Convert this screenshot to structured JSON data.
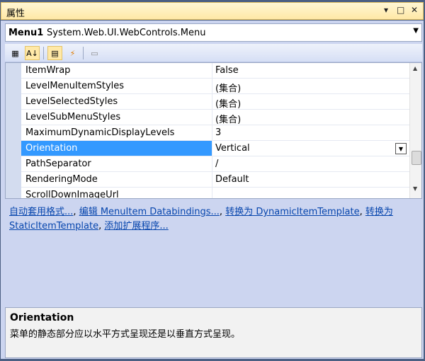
{
  "window": {
    "title": "属性",
    "controls": [
      "▾",
      "□",
      "✕"
    ]
  },
  "object_selector": {
    "name": "Menu1",
    "type": "System.Web.UI.WebControls.Menu"
  },
  "toolbar": {
    "buttons": [
      {
        "icon": "categorized-icon",
        "glyph": "▦"
      },
      {
        "icon": "alphabetical-icon",
        "glyph": "A↓"
      },
      {
        "icon": "properties-icon",
        "glyph": "▤"
      },
      {
        "icon": "events-icon",
        "glyph": "⚡"
      },
      {
        "icon": "property-pages-icon",
        "glyph": "▭"
      }
    ]
  },
  "properties": [
    {
      "name": "ItemWrap",
      "value": "False"
    },
    {
      "name": "LevelMenuItemStyles",
      "value": "(集合)"
    },
    {
      "name": "LevelSelectedStyles",
      "value": "(集合)"
    },
    {
      "name": "LevelSubMenuStyles",
      "value": "(集合)"
    },
    {
      "name": "MaximumDynamicDisplayLevels",
      "value": "3"
    },
    {
      "name": "Orientation",
      "value": "Vertical",
      "selected": true
    },
    {
      "name": "PathSeparator",
      "value": "/"
    },
    {
      "name": "RenderingMode",
      "value": "Default"
    },
    {
      "name": "ScrollDownImageUrl",
      "value": ""
    }
  ],
  "commands": {
    "auto_format": "自动套用格式...",
    "edit_bindings": "编辑 MenuItem Databindings...",
    "convert_dynamic": "转换为 DynamicItemTemplate",
    "convert_static": "转换为 StaticItemTemplate",
    "add_extender": "添加扩展程序...",
    "separator": ","
  },
  "description": {
    "title": "Orientation",
    "text": "菜单的静态部分应以水平方式呈现还是以垂直方式呈现。"
  }
}
